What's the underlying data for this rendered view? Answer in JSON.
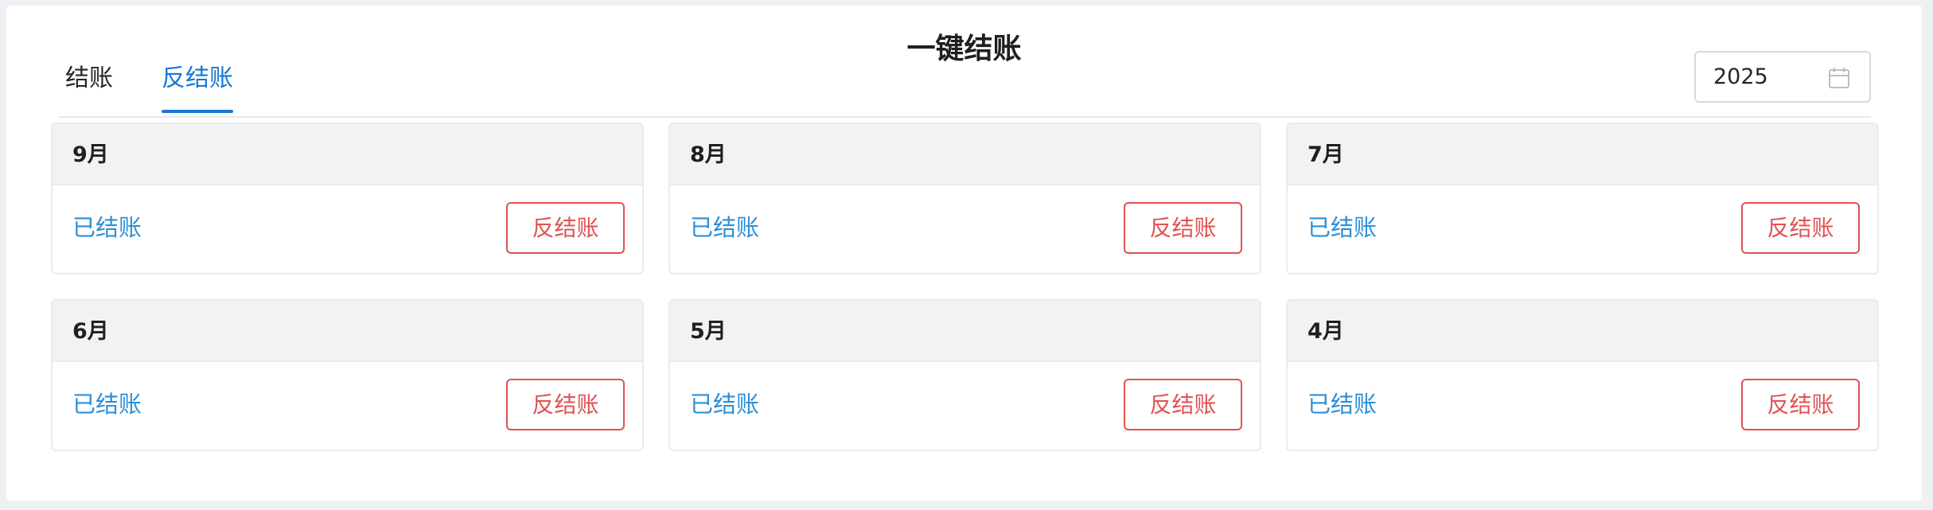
{
  "page": {
    "title": "一键结账"
  },
  "tabs": [
    {
      "label": "结账",
      "active": false
    },
    {
      "label": "反结账",
      "active": true
    }
  ],
  "year_picker": {
    "value": "2025",
    "icon": "calendar-icon"
  },
  "months": [
    {
      "label": "9月",
      "status": "已结账",
      "action": "反结账"
    },
    {
      "label": "8月",
      "status": "已结账",
      "action": "反结账"
    },
    {
      "label": "7月",
      "status": "已结账",
      "action": "反结账"
    },
    {
      "label": "6月",
      "status": "已结账",
      "action": "反结账"
    },
    {
      "label": "5月",
      "status": "已结账",
      "action": "反结账"
    },
    {
      "label": "4月",
      "status": "已结账",
      "action": "反结账"
    }
  ],
  "colors": {
    "accent_blue": "#1677d4",
    "status_blue": "#2b8fd8",
    "danger_red": "#e05252"
  }
}
